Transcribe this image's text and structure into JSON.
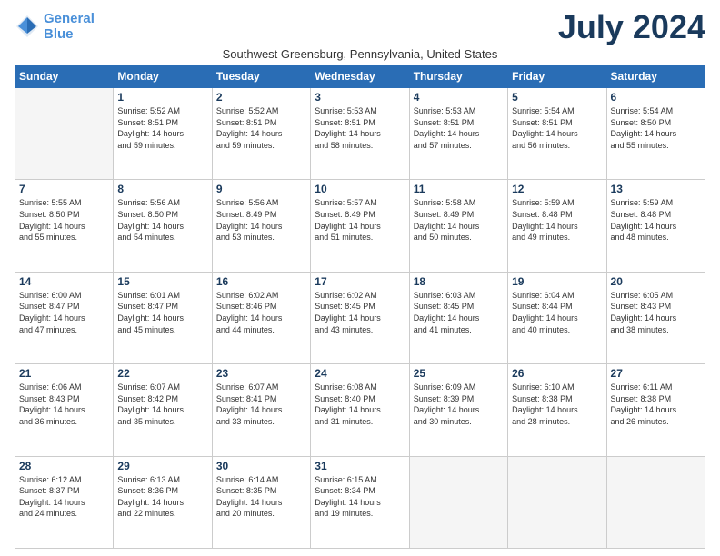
{
  "logo": {
    "line1": "General",
    "line2": "Blue"
  },
  "title": "July 2024",
  "location": "Southwest Greensburg, Pennsylvania, United States",
  "days_of_week": [
    "Sunday",
    "Monday",
    "Tuesday",
    "Wednesday",
    "Thursday",
    "Friday",
    "Saturday"
  ],
  "weeks": [
    [
      {
        "day": "",
        "info": ""
      },
      {
        "day": "1",
        "info": "Sunrise: 5:52 AM\nSunset: 8:51 PM\nDaylight: 14 hours\nand 59 minutes."
      },
      {
        "day": "2",
        "info": "Sunrise: 5:52 AM\nSunset: 8:51 PM\nDaylight: 14 hours\nand 59 minutes."
      },
      {
        "day": "3",
        "info": "Sunrise: 5:53 AM\nSunset: 8:51 PM\nDaylight: 14 hours\nand 58 minutes."
      },
      {
        "day": "4",
        "info": "Sunrise: 5:53 AM\nSunset: 8:51 PM\nDaylight: 14 hours\nand 57 minutes."
      },
      {
        "day": "5",
        "info": "Sunrise: 5:54 AM\nSunset: 8:51 PM\nDaylight: 14 hours\nand 56 minutes."
      },
      {
        "day": "6",
        "info": "Sunrise: 5:54 AM\nSunset: 8:50 PM\nDaylight: 14 hours\nand 55 minutes."
      }
    ],
    [
      {
        "day": "7",
        "info": "Sunrise: 5:55 AM\nSunset: 8:50 PM\nDaylight: 14 hours\nand 55 minutes."
      },
      {
        "day": "8",
        "info": "Sunrise: 5:56 AM\nSunset: 8:50 PM\nDaylight: 14 hours\nand 54 minutes."
      },
      {
        "day": "9",
        "info": "Sunrise: 5:56 AM\nSunset: 8:49 PM\nDaylight: 14 hours\nand 53 minutes."
      },
      {
        "day": "10",
        "info": "Sunrise: 5:57 AM\nSunset: 8:49 PM\nDaylight: 14 hours\nand 51 minutes."
      },
      {
        "day": "11",
        "info": "Sunrise: 5:58 AM\nSunset: 8:49 PM\nDaylight: 14 hours\nand 50 minutes."
      },
      {
        "day": "12",
        "info": "Sunrise: 5:59 AM\nSunset: 8:48 PM\nDaylight: 14 hours\nand 49 minutes."
      },
      {
        "day": "13",
        "info": "Sunrise: 5:59 AM\nSunset: 8:48 PM\nDaylight: 14 hours\nand 48 minutes."
      }
    ],
    [
      {
        "day": "14",
        "info": "Sunrise: 6:00 AM\nSunset: 8:47 PM\nDaylight: 14 hours\nand 47 minutes."
      },
      {
        "day": "15",
        "info": "Sunrise: 6:01 AM\nSunset: 8:47 PM\nDaylight: 14 hours\nand 45 minutes."
      },
      {
        "day": "16",
        "info": "Sunrise: 6:02 AM\nSunset: 8:46 PM\nDaylight: 14 hours\nand 44 minutes."
      },
      {
        "day": "17",
        "info": "Sunrise: 6:02 AM\nSunset: 8:45 PM\nDaylight: 14 hours\nand 43 minutes."
      },
      {
        "day": "18",
        "info": "Sunrise: 6:03 AM\nSunset: 8:45 PM\nDaylight: 14 hours\nand 41 minutes."
      },
      {
        "day": "19",
        "info": "Sunrise: 6:04 AM\nSunset: 8:44 PM\nDaylight: 14 hours\nand 40 minutes."
      },
      {
        "day": "20",
        "info": "Sunrise: 6:05 AM\nSunset: 8:43 PM\nDaylight: 14 hours\nand 38 minutes."
      }
    ],
    [
      {
        "day": "21",
        "info": "Sunrise: 6:06 AM\nSunset: 8:43 PM\nDaylight: 14 hours\nand 36 minutes."
      },
      {
        "day": "22",
        "info": "Sunrise: 6:07 AM\nSunset: 8:42 PM\nDaylight: 14 hours\nand 35 minutes."
      },
      {
        "day": "23",
        "info": "Sunrise: 6:07 AM\nSunset: 8:41 PM\nDaylight: 14 hours\nand 33 minutes."
      },
      {
        "day": "24",
        "info": "Sunrise: 6:08 AM\nSunset: 8:40 PM\nDaylight: 14 hours\nand 31 minutes."
      },
      {
        "day": "25",
        "info": "Sunrise: 6:09 AM\nSunset: 8:39 PM\nDaylight: 14 hours\nand 30 minutes."
      },
      {
        "day": "26",
        "info": "Sunrise: 6:10 AM\nSunset: 8:38 PM\nDaylight: 14 hours\nand 28 minutes."
      },
      {
        "day": "27",
        "info": "Sunrise: 6:11 AM\nSunset: 8:38 PM\nDaylight: 14 hours\nand 26 minutes."
      }
    ],
    [
      {
        "day": "28",
        "info": "Sunrise: 6:12 AM\nSunset: 8:37 PM\nDaylight: 14 hours\nand 24 minutes."
      },
      {
        "day": "29",
        "info": "Sunrise: 6:13 AM\nSunset: 8:36 PM\nDaylight: 14 hours\nand 22 minutes."
      },
      {
        "day": "30",
        "info": "Sunrise: 6:14 AM\nSunset: 8:35 PM\nDaylight: 14 hours\nand 20 minutes."
      },
      {
        "day": "31",
        "info": "Sunrise: 6:15 AM\nSunset: 8:34 PM\nDaylight: 14 hours\nand 19 minutes."
      },
      {
        "day": "",
        "info": ""
      },
      {
        "day": "",
        "info": ""
      },
      {
        "day": "",
        "info": ""
      }
    ]
  ]
}
